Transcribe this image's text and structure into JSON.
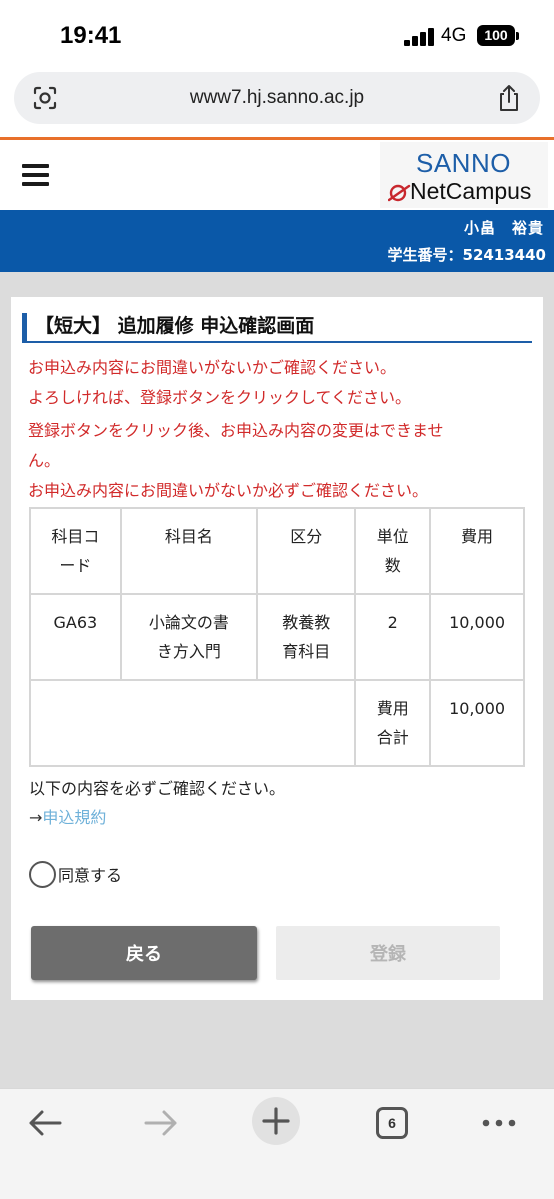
{
  "status_bar": {
    "time": "19:41",
    "network": "4G",
    "battery": "100"
  },
  "browser": {
    "url": "www7.hj.sanno.ac.jp"
  },
  "site": {
    "logo_top": "SANNO",
    "logo_bottom": "NetCampus"
  },
  "user": {
    "name": "小畠　裕貴",
    "student_id": "学生番号：52413440"
  },
  "page": {
    "title": "【短大】 追加履修 申込確認画面",
    "notice_lines_1": [
      "お申込み内容にお間違いがないかご確認ください。",
      "よろしければ、登録ボタンをクリックしてください。"
    ],
    "notice_lines_2": [
      "登録ボタンをクリック後、お申込み内容の変更はできませ",
      "ん。",
      "お申込み内容にお間違いがないか必ずご確認ください。"
    ]
  },
  "table": {
    "headers": [
      "科目コ|ード",
      "科目名",
      "区分",
      "単位|数",
      "費用"
    ],
    "row": [
      "GA63",
      "小論文の書|き方入門",
      "教養教|育科目",
      "2",
      "10,000"
    ],
    "total_label": "費用|合計",
    "total_value": "10,000"
  },
  "terms": {
    "confirm_text": "以下の内容を必ずご確認ください。",
    "arrow": "→",
    "link_label": "申込規約"
  },
  "agree": {
    "label": "同意する",
    "checked": false
  },
  "buttons": {
    "back": "戻る",
    "register": "登録"
  },
  "toolbar": {
    "tab_count": "6"
  },
  "colors": {
    "accent_blue": "#0a58a8",
    "notice_red": "#d12a2a",
    "orange": "#e8702a",
    "link": "#6fb1d9"
  }
}
